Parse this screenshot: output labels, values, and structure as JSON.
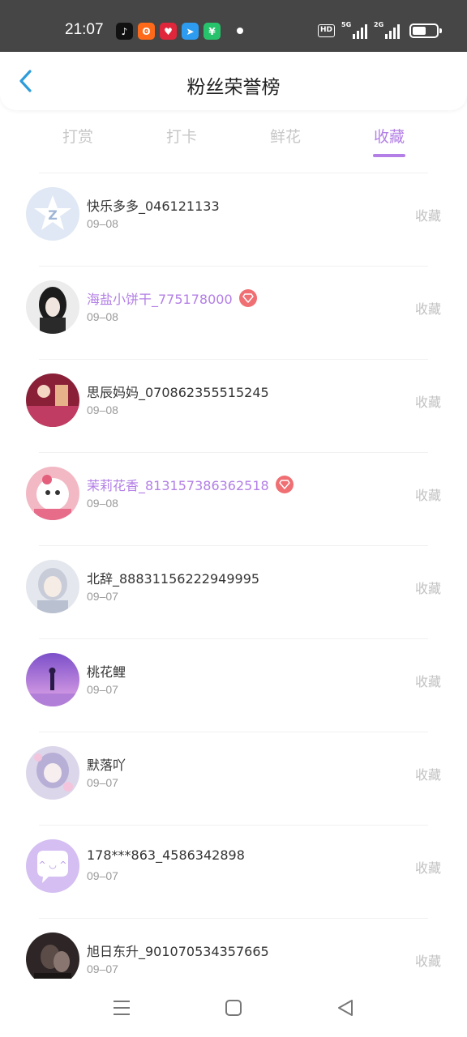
{
  "status_bar": {
    "time": "21:07",
    "hd_label": "HD",
    "signal1_label": "5G",
    "signal2_label": "2G"
  },
  "header": {
    "title": "粉丝荣誉榜"
  },
  "tabs": [
    {
      "label": "打赏"
    },
    {
      "label": "打卡"
    },
    {
      "label": "鲜花"
    },
    {
      "label": "收藏"
    }
  ],
  "active_tab": 3,
  "colors": {
    "accent": "#b37fe6",
    "badge": "#ef6f73",
    "status_bar_bg": "#464646"
  },
  "fans": [
    {
      "name": "快乐多多_046121133",
      "date": "09–08",
      "action": "收藏",
      "vip": false
    },
    {
      "name": "海盐小饼干_775178000",
      "date": "09–08",
      "action": "收藏",
      "vip": true
    },
    {
      "name": "思辰妈妈_070862355515245",
      "date": "09–08",
      "action": "收藏",
      "vip": false
    },
    {
      "name": "茉莉花香_813157386362518",
      "date": "09–08",
      "action": "收藏",
      "vip": true
    },
    {
      "name": "北辞_88831156222949995",
      "date": "09–07",
      "action": "收藏",
      "vip": false
    },
    {
      "name": "桃花鲤",
      "date": "09–07",
      "action": "收藏",
      "vip": false
    },
    {
      "name": "默落吖",
      "date": "09–07",
      "action": "收藏",
      "vip": false
    },
    {
      "name": "178***863_4586342898",
      "date": "09–07",
      "action": "收藏",
      "vip": false
    },
    {
      "name": "旭日东升_901070534357665",
      "date": "09–07",
      "action": "收藏",
      "vip": false
    }
  ]
}
